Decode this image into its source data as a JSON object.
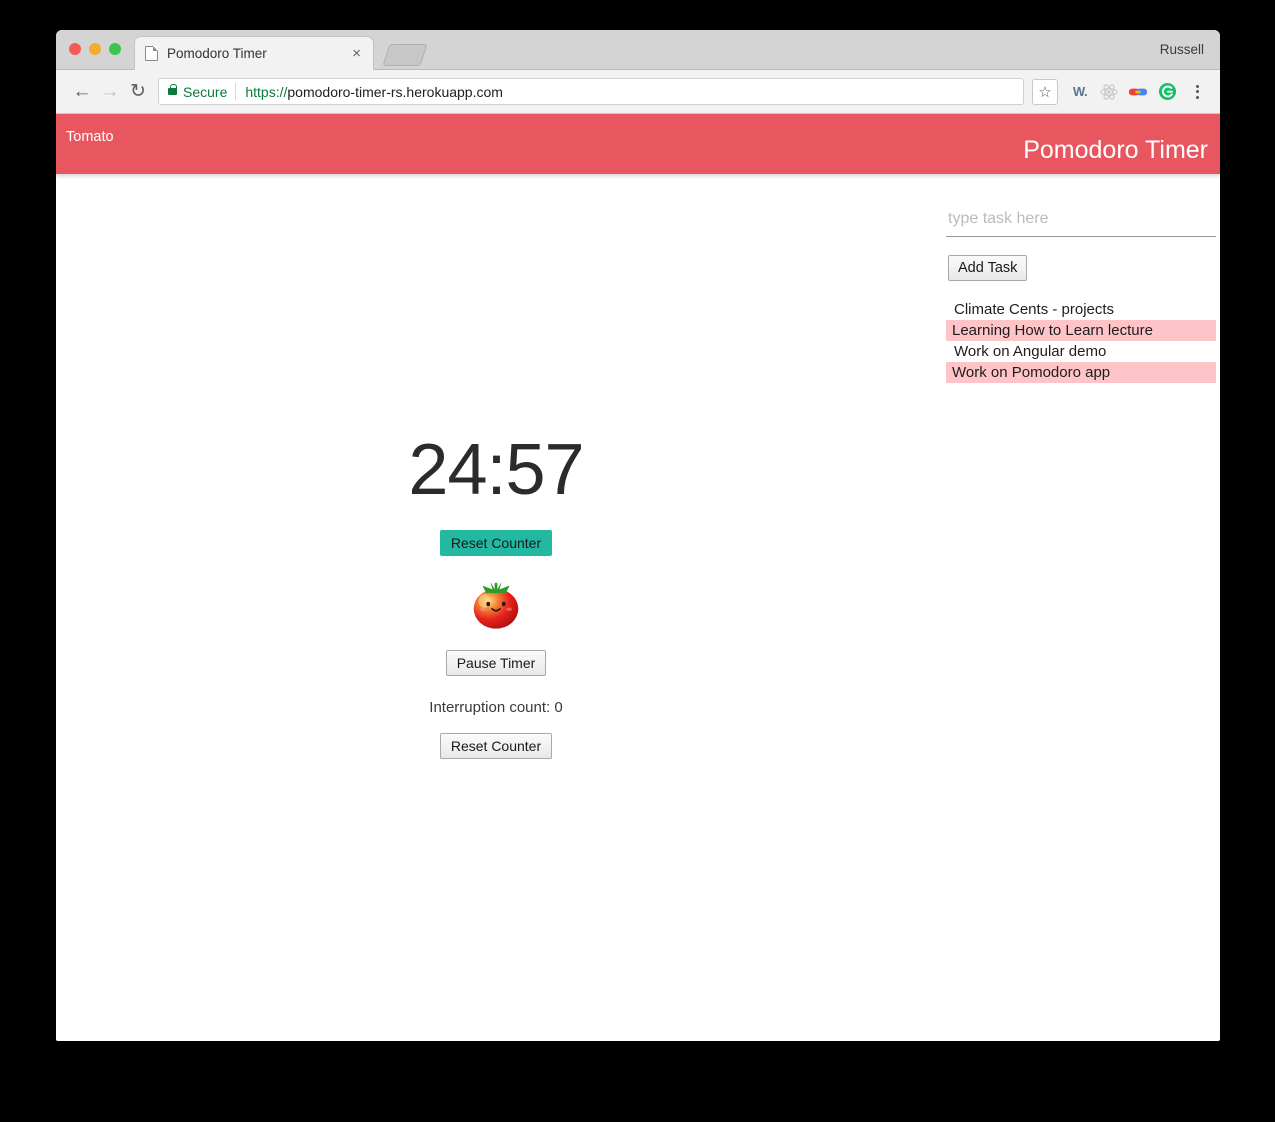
{
  "browser": {
    "profile_name": "Russell",
    "tab": {
      "title": "Pomodoro Timer",
      "favicon": "page-icon",
      "close_label": "×"
    },
    "new_tab_label": "",
    "nav": {
      "back": "←",
      "forward": "→",
      "reload": "↻"
    },
    "omnibox": {
      "security_label": "Secure",
      "url_scheme": "https://",
      "url_rest": "pomodoro-timer-rs.herokuapp.com",
      "star": "☆"
    },
    "extensions": [
      {
        "name": "wikiwand-extension-icon",
        "label": "W."
      },
      {
        "name": "react-devtools-icon",
        "label": ""
      },
      {
        "name": "google-link-icon",
        "label": ""
      },
      {
        "name": "grammarly-icon",
        "label": "G"
      }
    ],
    "menu_label": "chrome-menu"
  },
  "app": {
    "brand": "Tomato",
    "title": "Pomodoro Timer",
    "header_color": "#e8575f"
  },
  "timer": {
    "display": "24:57",
    "reset_counter_top_label": "Reset Counter",
    "pause_label": "Pause Timer",
    "interruption_text": "Interruption count: 0",
    "reset_counter_bottom_label": "Reset Counter",
    "mascot": "tomato-icon",
    "accent_color": "#23b8a0"
  },
  "tasks": {
    "input_value": "",
    "input_placeholder": "type task here",
    "add_button_label": "Add Task",
    "highlight_color": "#ffc4c8",
    "items": [
      {
        "label": "Climate Cents - projects",
        "highlighted": false
      },
      {
        "label": "Learning How to Learn lecture",
        "highlighted": true
      },
      {
        "label": "Work on Angular demo",
        "highlighted": false
      },
      {
        "label": "Work on Pomodoro app",
        "highlighted": true
      }
    ]
  }
}
